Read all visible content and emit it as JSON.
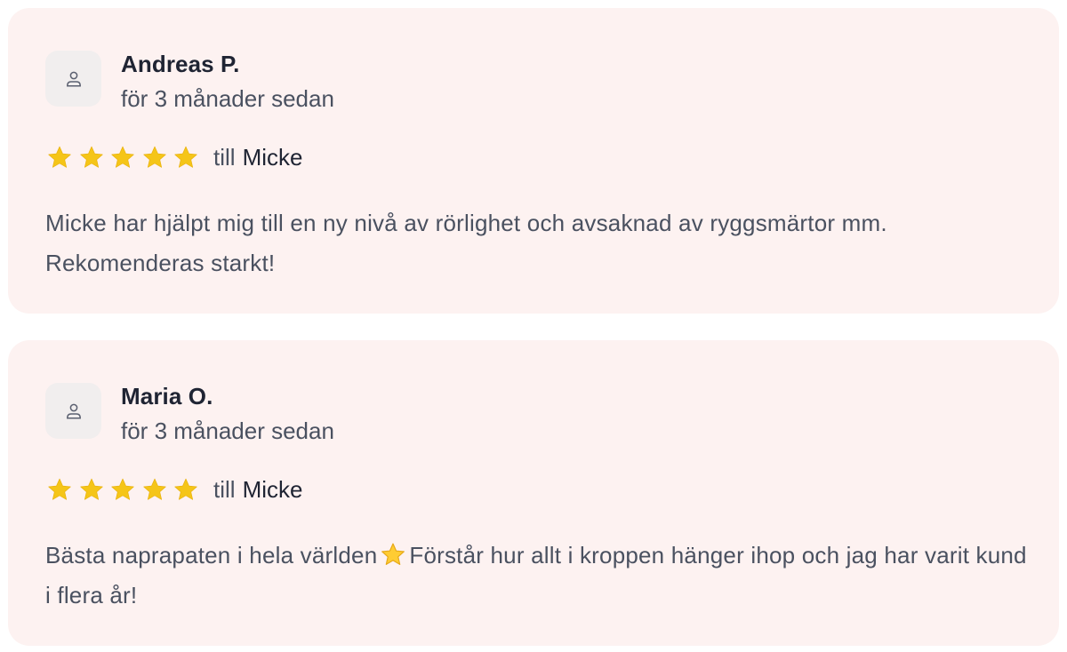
{
  "colors": {
    "card_background": "#fdf2f1",
    "star": "#f5c518",
    "name_text": "#1f2433",
    "body_text": "#4a5160"
  },
  "reviews": [
    {
      "avatar_icon": "user-icon",
      "name": "Andreas P.",
      "date": "för 3 månader sedan",
      "rating": 5,
      "max_rating": 5,
      "till_label": "till",
      "practitioner": "Micke",
      "text": "Micke har hjälpt mig till en ny nivå av rörlighet och avsaknad av ryggsmärtor mm. Rekomenderas starkt!"
    },
    {
      "avatar_icon": "user-icon",
      "name": "Maria O.",
      "date": "för 3 månader sedan",
      "rating": 5,
      "max_rating": 5,
      "till_label": "till",
      "practitioner": "Micke",
      "text_before_emoji": "Bästa naprapaten i hela världen",
      "emoji": "star-emoji",
      "text_after_emoji": "Förstår hur allt i kroppen hänger ihop och jag har varit kund i flera år!"
    }
  ]
}
